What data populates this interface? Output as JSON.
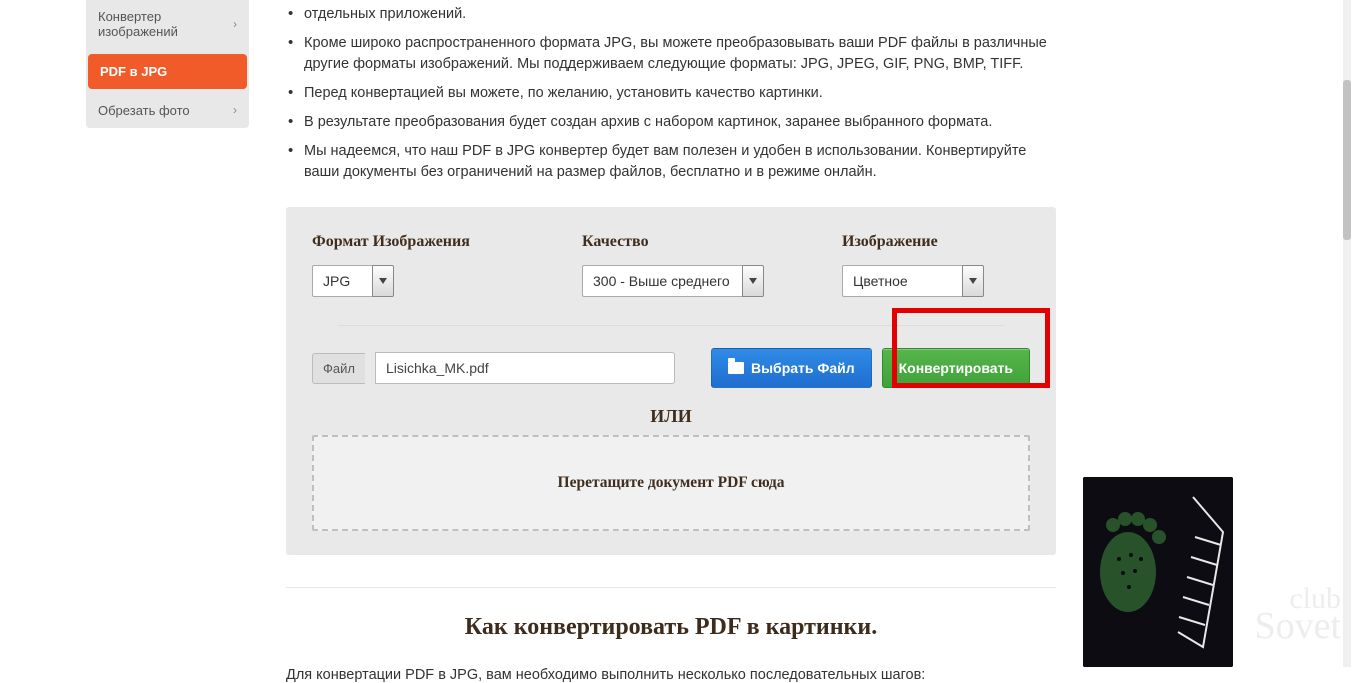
{
  "sidebar": {
    "items": [
      {
        "label": "Конвертер изображений"
      },
      {
        "label": "PDF в JPG"
      },
      {
        "label": "Обрезать фото"
      }
    ]
  },
  "bullets": [
    "отдельных приложений.",
    "Кроме широко распространенного формата JPG, вы можете преобразовывать ваши PDF файлы в различные другие форматы изображений. Мы поддерживаем следующие форматы: JPG, JPEG, GIF, PNG, BMP, TIFF.",
    "Перед конвертацией вы можете, по желанию, установить качество картинки.",
    "В результате преобразования будет создан архив с набором картинок, заранее выбранного формата.",
    "Мы надеемся, что наш PDF в JPG конвертер будет вам полезен и удобен в использовании. Конвертируйте ваши документы без ограничений на размер файлов, бесплатно и в режиме онлайн."
  ],
  "panel": {
    "format_label": "Формат Изображения",
    "format_value": "JPG",
    "quality_label": "Качество",
    "quality_value": "300 - Выше среднего",
    "image_label": "Изображение",
    "image_value": "Цветное",
    "file_label": "Файл",
    "file_name": "Lisichka_MK.pdf",
    "choose_button": "Выбрать Файл",
    "convert_button": "Конвертировать",
    "or_label": "ИЛИ",
    "dropzone_text": "Перетащите документ PDF сюда"
  },
  "heading2": "Как конвертировать PDF в картинки.",
  "paragraph": "Для конвертации PDF в JPG, вам необходимо выполнить несколько последовательных шагов:",
  "watermark_l1": "club",
  "watermark_l2": "Sovet"
}
